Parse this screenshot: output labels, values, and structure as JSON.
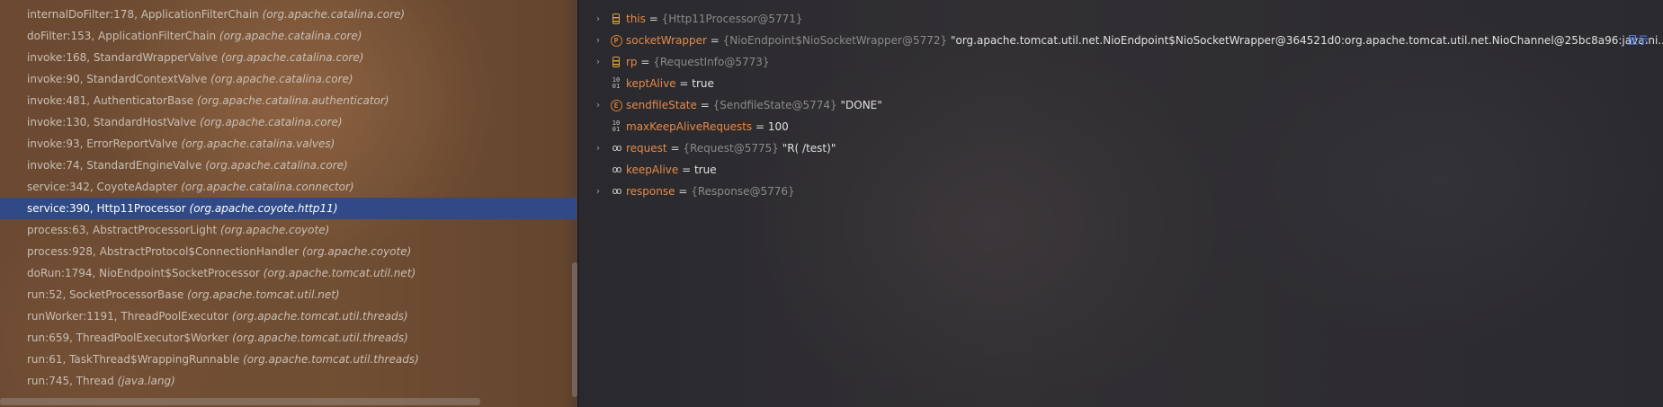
{
  "frames": [
    {
      "method": "internalDoFilter:178, ApplicationFilterChain",
      "pkg": "(org.apache.catalina.core)",
      "selected": false
    },
    {
      "method": "doFilter:153, ApplicationFilterChain",
      "pkg": "(org.apache.catalina.core)",
      "selected": false
    },
    {
      "method": "invoke:168, StandardWrapperValve",
      "pkg": "(org.apache.catalina.core)",
      "selected": false
    },
    {
      "method": "invoke:90, StandardContextValve",
      "pkg": "(org.apache.catalina.core)",
      "selected": false
    },
    {
      "method": "invoke:481, AuthenticatorBase",
      "pkg": "(org.apache.catalina.authenticator)",
      "selected": false
    },
    {
      "method": "invoke:130, StandardHostValve",
      "pkg": "(org.apache.catalina.core)",
      "selected": false
    },
    {
      "method": "invoke:93, ErrorReportValve",
      "pkg": "(org.apache.catalina.valves)",
      "selected": false
    },
    {
      "method": "invoke:74, StandardEngineValve",
      "pkg": "(org.apache.catalina.core)",
      "selected": false
    },
    {
      "method": "service:342, CoyoteAdapter",
      "pkg": "(org.apache.catalina.connector)",
      "selected": false
    },
    {
      "method": "service:390, Http11Processor",
      "pkg": "(org.apache.coyote.http11)",
      "selected": true
    },
    {
      "method": "process:63, AbstractProcessorLight",
      "pkg": "(org.apache.coyote)",
      "selected": false
    },
    {
      "method": "process:928, AbstractProtocol$ConnectionHandler",
      "pkg": "(org.apache.coyote)",
      "selected": false
    },
    {
      "method": "doRun:1794, NioEndpoint$SocketProcessor",
      "pkg": "(org.apache.tomcat.util.net)",
      "selected": false
    },
    {
      "method": "run:52, SocketProcessorBase",
      "pkg": "(org.apache.tomcat.util.net)",
      "selected": false
    },
    {
      "method": "runWorker:1191, ThreadPoolExecutor",
      "pkg": "(org.apache.tomcat.util.threads)",
      "selected": false
    },
    {
      "method": "run:659, ThreadPoolExecutor$Worker",
      "pkg": "(org.apache.tomcat.util.threads)",
      "selected": false
    },
    {
      "method": "run:61, TaskThread$WrappingRunnable",
      "pkg": "(org.apache.tomcat.util.threads)",
      "selected": false
    },
    {
      "method": "run:745, Thread",
      "pkg": "(java.lang)",
      "selected": false
    }
  ],
  "variables": [
    {
      "expandable": true,
      "icon": "field-icon",
      "name": "this",
      "eq": " = ",
      "type": "{Http11Processor@5771}",
      "value": ""
    },
    {
      "expandable": true,
      "icon": "protected-icon",
      "name": "socketWrapper",
      "eq": " = ",
      "type": "{NioEndpoint$NioSocketWrapper@5772}",
      "value": " \"org.apache.tomcat.util.net.NioEndpoint$NioSocketWrapper@364521d0:org.apache.tomcat.util.net.NioChannel@25bc8a96:java.ni...",
      "link": "显示"
    },
    {
      "expandable": true,
      "icon": "field-icon",
      "name": "rp",
      "eq": " = ",
      "type": "{RequestInfo@5773}",
      "value": ""
    },
    {
      "expandable": false,
      "icon": "primitive-icon",
      "name": "keptAlive",
      "eq": " = ",
      "type": "",
      "value": "true"
    },
    {
      "expandable": true,
      "icon": "enum-icon",
      "name": "sendfileState",
      "eq": " = ",
      "type": "{SendfileState@5774}",
      "value": " \"DONE\""
    },
    {
      "expandable": false,
      "icon": "primitive-icon",
      "name": "maxKeepAliveRequests",
      "eq": " = ",
      "type": "",
      "value": "100"
    },
    {
      "expandable": true,
      "icon": "watch-icon",
      "name": "request",
      "eq": " = ",
      "type": "{Request@5775}",
      "value": " \"R( /test)\""
    },
    {
      "expandable": false,
      "icon": "watch-icon",
      "name": "keepAlive",
      "eq": " = ",
      "type": "",
      "value": "true"
    },
    {
      "expandable": true,
      "icon": "watch-icon",
      "name": "response",
      "eq": " = ",
      "type": "{Response@5776}",
      "value": ""
    }
  ],
  "icons": {
    "field-icon": "≡",
    "protected-icon": "P",
    "enum-icon": "E",
    "primitive-icon": "10/01",
    "watch-icon": "∞",
    "chevron": "›"
  },
  "colors": {
    "selected_row": "#2f4a86",
    "var_name": "#e58a4b",
    "link": "#5a8cff"
  }
}
